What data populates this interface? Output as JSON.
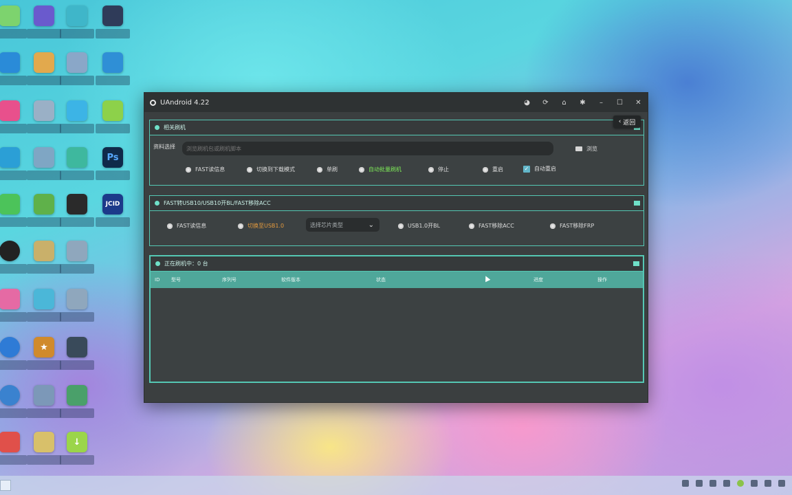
{
  "window": {
    "title": "UAndroid 4.22",
    "back_label": "返回"
  },
  "panel_related": {
    "title": "相关刷机",
    "path_label": "资料选择",
    "path_placeholder": "浏览刷机包或刷机脚本",
    "browse_label": "浏览",
    "options": [
      "FAST读信息",
      "切换到下载模式",
      "单刷",
      "自动批量刷机",
      "停止",
      "重启"
    ],
    "auto_restart": "自动重启"
  },
  "panel_fast": {
    "title": "FAST转USB10/USB10开BL/FAST移除ACC",
    "options": [
      "FAST读信息",
      "切换至USB1.0"
    ],
    "chip_select_placeholder": "选择芯片类型",
    "options_right": [
      "USB1.0开BL",
      "FAST移除ACC",
      "FAST移除FRP"
    ]
  },
  "panel_flashing": {
    "title": "正在刷机中：0 台",
    "columns": [
      "ID",
      "型号",
      "序列号",
      "软件版本",
      "状态",
      "进度",
      "操作"
    ]
  }
}
